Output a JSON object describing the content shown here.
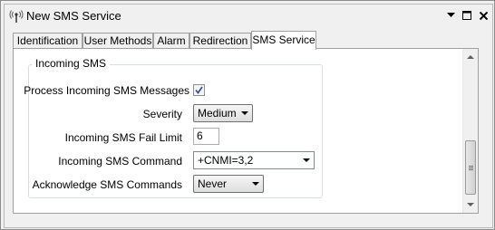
{
  "window": {
    "title": "New SMS Service",
    "accent": "#1e5aa8"
  },
  "tabs": [
    {
      "label": "Identification",
      "active": false
    },
    {
      "label": "User Methods",
      "active": false
    },
    {
      "label": "Alarm",
      "active": false
    },
    {
      "label": "Redirection",
      "active": false
    },
    {
      "label": "SMS Service",
      "active": true
    }
  ],
  "group": {
    "title": "Incoming SMS",
    "process_label": "Process Incoming SMS Messages",
    "process_checked": true,
    "severity_label": "Severity",
    "severity_value": "Medium",
    "fail_limit_label": "Incoming SMS Fail Limit",
    "fail_limit_value": "6",
    "command_label": "Incoming SMS Command",
    "command_value": "+CNMI=3,2",
    "ack_label": "Acknowledge SMS Commands",
    "ack_value": "Never"
  },
  "icons": {
    "window": "antenna-icon",
    "minimize": "dropdown-arrow-icon",
    "maximize": "maximize-icon",
    "close": "close-icon"
  }
}
